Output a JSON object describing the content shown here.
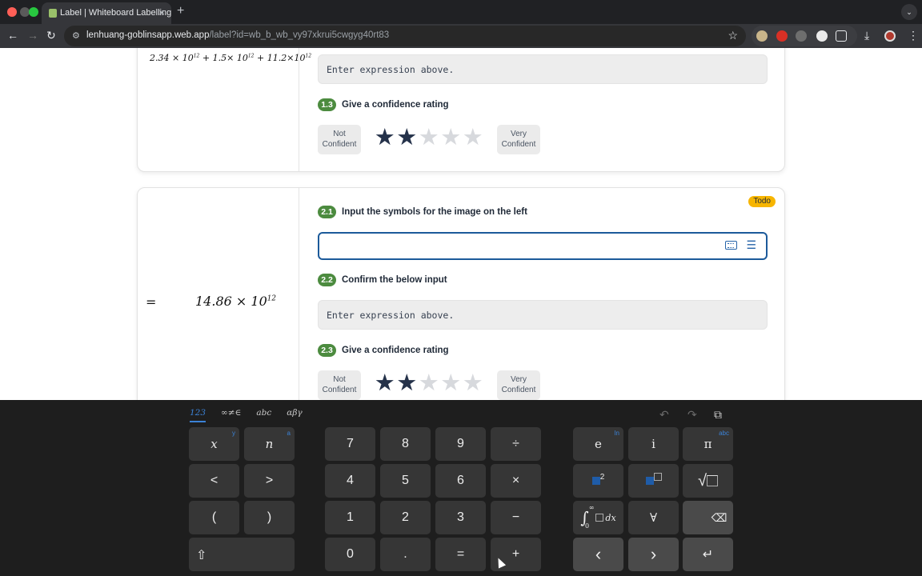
{
  "browser": {
    "tab_title": "Label | Whiteboard Labelling",
    "url_host": "lenhuang-goblinsapp.web.app",
    "url_path": "/label?id=wb_b_wb_vy97xkrui5cwgyg40rt83",
    "new_tab": "+",
    "tab_close": "×",
    "tab_menu": "⌄"
  },
  "cards": [
    {
      "handwriting": "2.34 × 10",
      "handwriting_sup": "12",
      "handwriting_2": "+ 1.5× 10",
      "handwriting_2_sup": "12",
      "handwriting_3": "+ 11.2×10",
      "handwriting_3_sup": "12",
      "expression_placeholder": "Enter expression above.",
      "confidence": {
        "badge": "1.3",
        "label": "Give a confidence rating",
        "rating": 2,
        "max": 5
      },
      "not_confident": [
        "Not",
        "Confident"
      ],
      "very_confident": [
        "Very",
        "Confident"
      ]
    },
    {
      "status": "Todo",
      "handwriting_eq": "=",
      "handwriting": "14.86 × 10",
      "handwriting_sup": "12",
      "input_question": {
        "badge": "2.1",
        "label": "Input the symbols for the image on the left"
      },
      "confirm_question": {
        "badge": "2.2",
        "label": "Confirm the below input"
      },
      "expression_placeholder": "Enter expression above.",
      "confidence": {
        "badge": "2.3",
        "label": "Give a confidence rating",
        "rating": 2,
        "max": 5
      },
      "not_confident": [
        "Not",
        "Confident"
      ],
      "very_confident": [
        "Very",
        "Confident"
      ]
    }
  ],
  "keyboard": {
    "tabs": [
      "123",
      "∞≠∈",
      "abc",
      "αβγ"
    ],
    "keys": {
      "x": "x",
      "x_sub": "y",
      "n": "n",
      "n_sub": "a",
      "k7": "7",
      "k8": "8",
      "k9": "9",
      "div": "÷",
      "e": "e",
      "e_sub": "ln",
      "i": "i",
      "pi": "π",
      "pi_sub": "abc",
      "lt": "<",
      "gt": ">",
      "k4": "4",
      "k5": "5",
      "k6": "6",
      "mul": "×",
      "sq_sup": "2",
      "lparen": "(",
      "rparen": ")",
      "k1": "1",
      "k2": "2",
      "k3": "3",
      "minus": "−",
      "int_sup": "∞",
      "int_sub": "0",
      "int_dx": "dx",
      "forall": "∀",
      "k0": "0",
      "dot": ".",
      "eq": "=",
      "plus": "+",
      "left": "‹",
      "right": "›",
      "enter": "↵",
      "shift": "⇧"
    }
  }
}
